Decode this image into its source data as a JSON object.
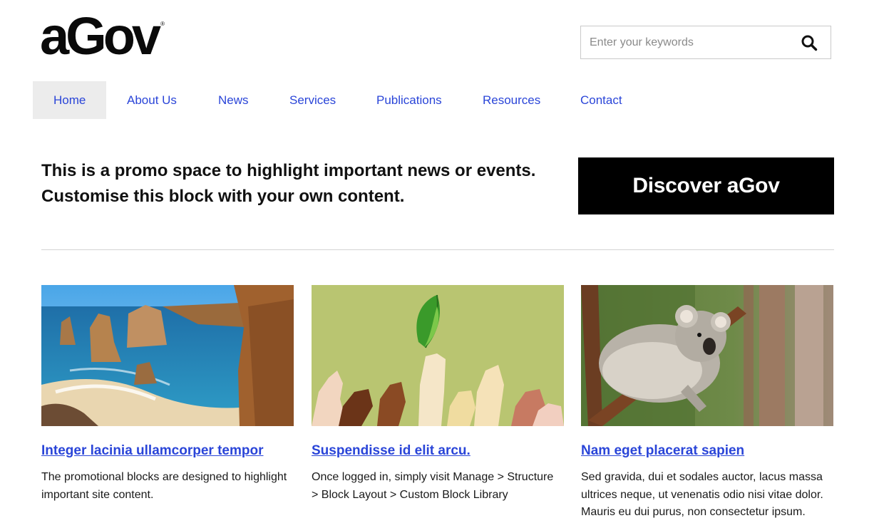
{
  "logo": {
    "text": "aGov",
    "mark": "®"
  },
  "search": {
    "placeholder": "Enter your keywords",
    "value": "",
    "icon": "search-icon"
  },
  "nav": {
    "items": [
      {
        "label": "Home",
        "active": true
      },
      {
        "label": "About Us"
      },
      {
        "label": "News"
      },
      {
        "label": "Services"
      },
      {
        "label": "Publications"
      },
      {
        "label": "Resources"
      },
      {
        "label": "Contact"
      }
    ]
  },
  "promo": {
    "line1": "This is a promo space to highlight important news or events.",
    "line2": "Customise this block with your own content.",
    "button_label": "Discover aGov"
  },
  "cards": [
    {
      "title": "Integer lacinia ullamcorper tempor",
      "body": "The promotional blocks are designed to highlight important site content.",
      "image": "coastal-cliffs-photo"
    },
    {
      "title": "Suspendisse id elit arcu.",
      "body": "Once logged in, simply visit Manage > Structure > Block Layout > Custom Block Library",
      "image": "raised-hands-leaf-illustration"
    },
    {
      "title": "Nam eget placerat sapien",
      "body": "Sed gravida, dui et sodales auctor, lacus massa ultrices neque, ut venenatis odio nisi vitae dolor. Mauris eu dui purus, non consectetur ipsum.",
      "image": "koala-photo"
    }
  ],
  "colors": {
    "link": "#2a45d8",
    "nav_active_bg": "#ececec",
    "button_bg": "#000000",
    "divider": "#d4d4d4"
  }
}
